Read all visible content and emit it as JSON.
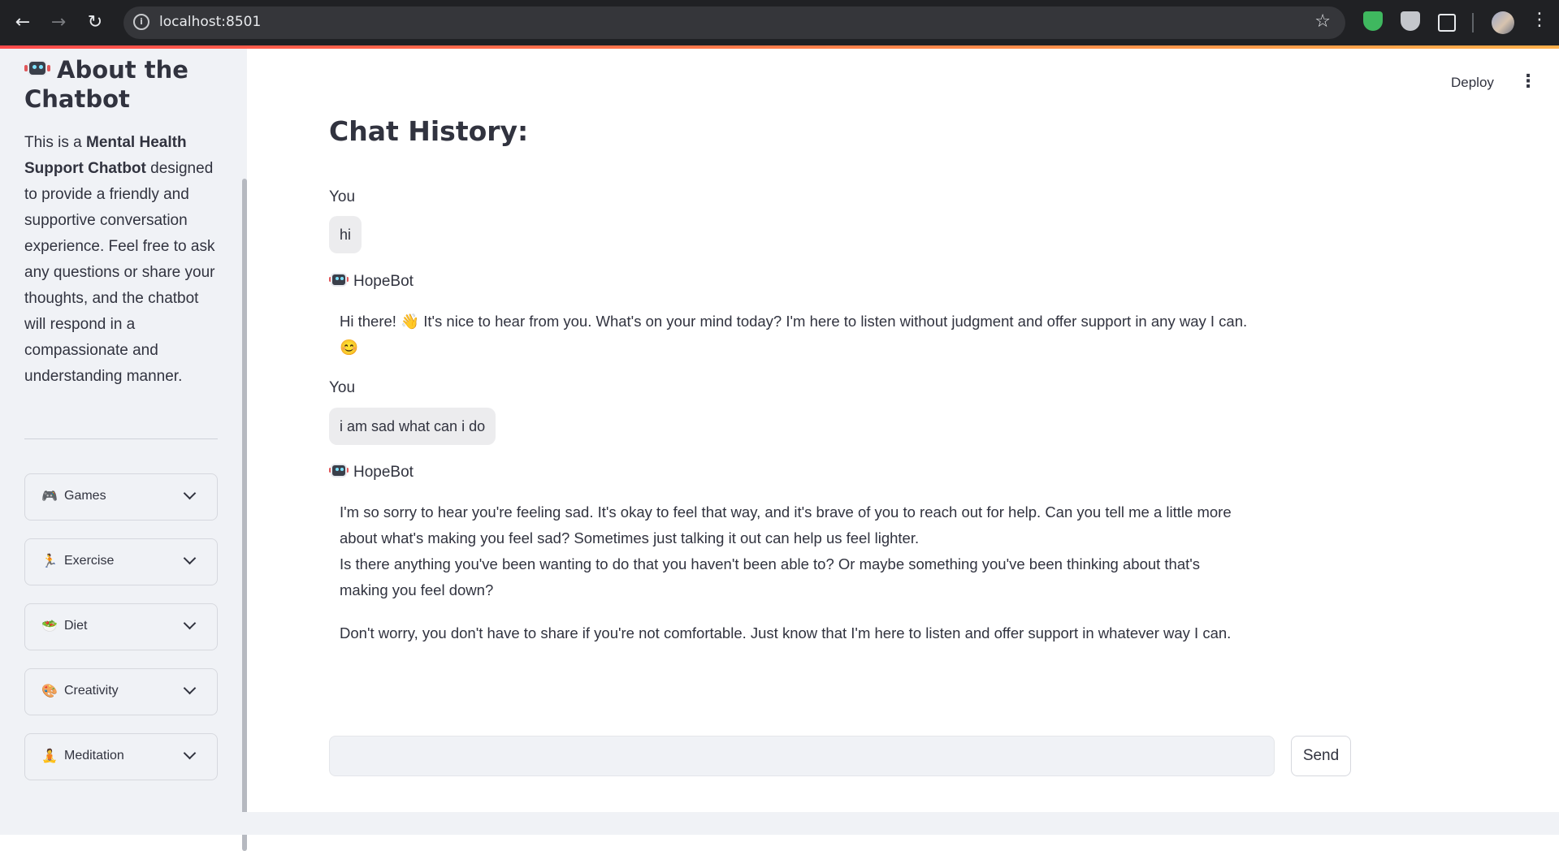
{
  "browser": {
    "url": "localhost:8501",
    "info_glyph": "i"
  },
  "sidebar": {
    "title": "About the Chatbot",
    "description": {
      "prefix": "This is a ",
      "bold": "Mental Health Support Chatbot",
      "suffix": " designed to provide a friendly and supportive conversation experience. Feel free to ask any questions or share your thoughts, and the chatbot will respond in a compassionate and understanding manner."
    },
    "expanders": [
      {
        "icon": "🎮",
        "icon_name": "game-controller-icon",
        "label": "Games"
      },
      {
        "icon": "🏃",
        "icon_name": "runner-icon",
        "label": "Exercise"
      },
      {
        "icon": "🥗",
        "icon_name": "salad-icon",
        "label": "Diet"
      },
      {
        "icon": "🎨",
        "icon_name": "palette-icon",
        "label": "Creativity"
      },
      {
        "icon": "🧘",
        "icon_name": "meditation-icon",
        "label": "Meditation"
      }
    ]
  },
  "header": {
    "deploy_label": "Deploy",
    "menu_glyph": "⋮"
  },
  "main": {
    "title": "Chat History:",
    "messages": [
      {
        "speaker": "You",
        "text": "hi"
      },
      {
        "speaker": "HopeBot",
        "paragraphs": [
          "Hi there! 👋 It's nice to hear from you. What's on your mind today? I'm here to listen without judgment and offer support in any way I can. 😊"
        ]
      },
      {
        "speaker": "You",
        "text": "i am sad what can i do"
      },
      {
        "speaker": "HopeBot",
        "paragraphs": [
          "I'm so sorry to hear you're feeling sad. It's okay to feel that way, and it's brave of you to reach out for help. Can you tell me a little more about what's making you feel sad? Sometimes just talking it out can help us feel lighter.",
          "Is there anything you've been wanting to do that you haven't been able to? Or maybe something you've been thinking about that's making you feel down?",
          "Don't worry, you don't have to share if you're not comfortable. Just know that I'm here to listen and offer support in whatever way I can."
        ]
      }
    ],
    "input": {
      "value": "",
      "placeholder": ""
    },
    "send_label": "Send"
  },
  "colors": {
    "accent_start": "#ff4b4b",
    "accent_end": "#ffb04b",
    "sidebar_bg": "#f0f2f6",
    "text": "#31333f"
  }
}
